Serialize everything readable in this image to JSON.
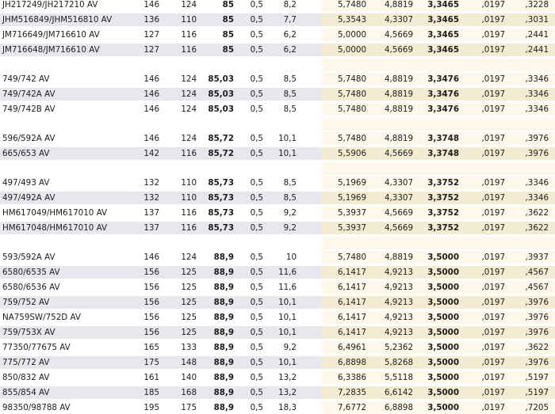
{
  "table": {
    "groups": [
      {
        "rows": [
          [
            "JH217249/JH217210 AV",
            "146",
            "124",
            "85",
            "0,5",
            "8,2",
            "5,7480",
            "4,8819",
            "3,3465",
            ",0197",
            ",3228"
          ],
          [
            "JHM516849/JHM516810 AV",
            "136",
            "110",
            "85",
            "0,5",
            "7,7",
            "5,3543",
            "4,3307",
            "3,3465",
            ",0197",
            ",3031"
          ],
          [
            "JM716649/JM716610 AV",
            "127",
            "116",
            "85",
            "0,5",
            "6,2",
            "5,0000",
            "4,5669",
            "3,3465",
            ",0197",
            ",2441"
          ],
          [
            "JM716648/JM716610 AV",
            "127",
            "116",
            "85",
            "0,5",
            "6,2",
            "5,0000",
            "4,5669",
            "3,3465",
            ",0197",
            ",2441"
          ]
        ]
      },
      {
        "rows": [
          [
            "749/742 AV",
            "146",
            "124",
            "85,03",
            "0,5",
            "8,5",
            "5,7480",
            "4,8819",
            "3,3476",
            ",0197",
            ",3346"
          ],
          [
            "749/742A AV",
            "146",
            "124",
            "85,03",
            "0,5",
            "8,5",
            "5,7480",
            "4,8819",
            "3,3476",
            ",0197",
            ",3346"
          ],
          [
            "749/742B AV",
            "146",
            "124",
            "85,03",
            "0,5",
            "8,5",
            "5,7480",
            "4,8819",
            "3,3476",
            ",0197",
            ",3346"
          ]
        ]
      },
      {
        "rows": [
          [
            "596/592A AV",
            "146",
            "124",
            "85,72",
            "0,5",
            "10,1",
            "5,7480",
            "4,8819",
            "3,3748",
            ",0197",
            ",3976"
          ],
          [
            "665/653 AV",
            "142",
            "116",
            "85,72",
            "0,5",
            "10,1",
            "5,5906",
            "4,5669",
            "3,3748",
            ",0197",
            ",3976"
          ]
        ]
      },
      {
        "rows": [
          [
            "497/493 AV",
            "132",
            "110",
            "85,73",
            "0,5",
            "8,5",
            "5,1969",
            "4,3307",
            "3,3752",
            ",0197",
            ",3346"
          ],
          [
            "497/492A AV",
            "132",
            "110",
            "85,73",
            "0,5",
            "8,5",
            "5,1969",
            "4,3307",
            "3,3752",
            ",0197",
            ",3346"
          ],
          [
            "HM617049/HM617010 AV",
            "137",
            "116",
            "85,73",
            "0,5",
            "9,2",
            "5,3937",
            "4,5669",
            "3,3752",
            ",0197",
            ",3622"
          ],
          [
            "HM617048/HM617010 AV",
            "137",
            "116",
            "85,73",
            "0,5",
            "9,2",
            "5,3937",
            "4,5669",
            "3,3752",
            ",0197",
            ",3622"
          ]
        ]
      },
      {
        "rows": [
          [
            "593/592A AV",
            "146",
            "124",
            "88,9",
            "0,5",
            "10",
            "5,7480",
            "4,8819",
            "3,5000",
            ",0197",
            ",3937"
          ],
          [
            "6580/6535 AV",
            "156",
            "125",
            "88,9",
            "0,5",
            "11,6",
            "6,1417",
            "4,9213",
            "3,5000",
            ",0197",
            ",4567"
          ],
          [
            "6580/6536 AV",
            "156",
            "125",
            "88,9",
            "0,5",
            "11,6",
            "6,1417",
            "4,9213",
            "3,5000",
            ",0197",
            ",4567"
          ],
          [
            "759/752 AV",
            "156",
            "125",
            "88,9",
            "0,5",
            "10,1",
            "6,1417",
            "4,9213",
            "3,5000",
            ",0197",
            ",3976"
          ],
          [
            "NA759SW/752D AV",
            "156",
            "125",
            "88,9",
            "0,5",
            "10,1",
            "6,1417",
            "4,9213",
            "3,5000",
            ",0197",
            ",3976"
          ],
          [
            "759/753X AV",
            "156",
            "125",
            "88,9",
            "0,5",
            "10,1",
            "6,1417",
            "4,9213",
            "3,5000",
            ",0197",
            ",3976"
          ],
          [
            "77350/77675 AV",
            "165",
            "133",
            "88,9",
            "0,5",
            "9,2",
            "6,4961",
            "5,2362",
            "3,5000",
            ",0197",
            ",3622"
          ],
          [
            "775/772 AV",
            "175",
            "148",
            "88,9",
            "0,5",
            "10,1",
            "6,8898",
            "5,8268",
            "3,5000",
            ",0197",
            ",3976"
          ],
          [
            "850/832 AV",
            "161",
            "140",
            "88,9",
            "0,5",
            "13,2",
            "6,3386",
            "5,5118",
            "3,5000",
            ",0197",
            ",5197"
          ],
          [
            "855/854 AV",
            "185",
            "168",
            "88,9",
            "0,5",
            "13,2",
            "7,2835",
            "6,6142",
            "3,5000",
            ",0197",
            ",5197"
          ],
          [
            "98350/98788 AV",
            "195",
            "175",
            "88,9",
            "0,5",
            "18,3",
            "7,6772",
            "6,8898",
            "3,5000",
            ",0197",
            ",7205"
          ]
        ]
      }
    ]
  }
}
